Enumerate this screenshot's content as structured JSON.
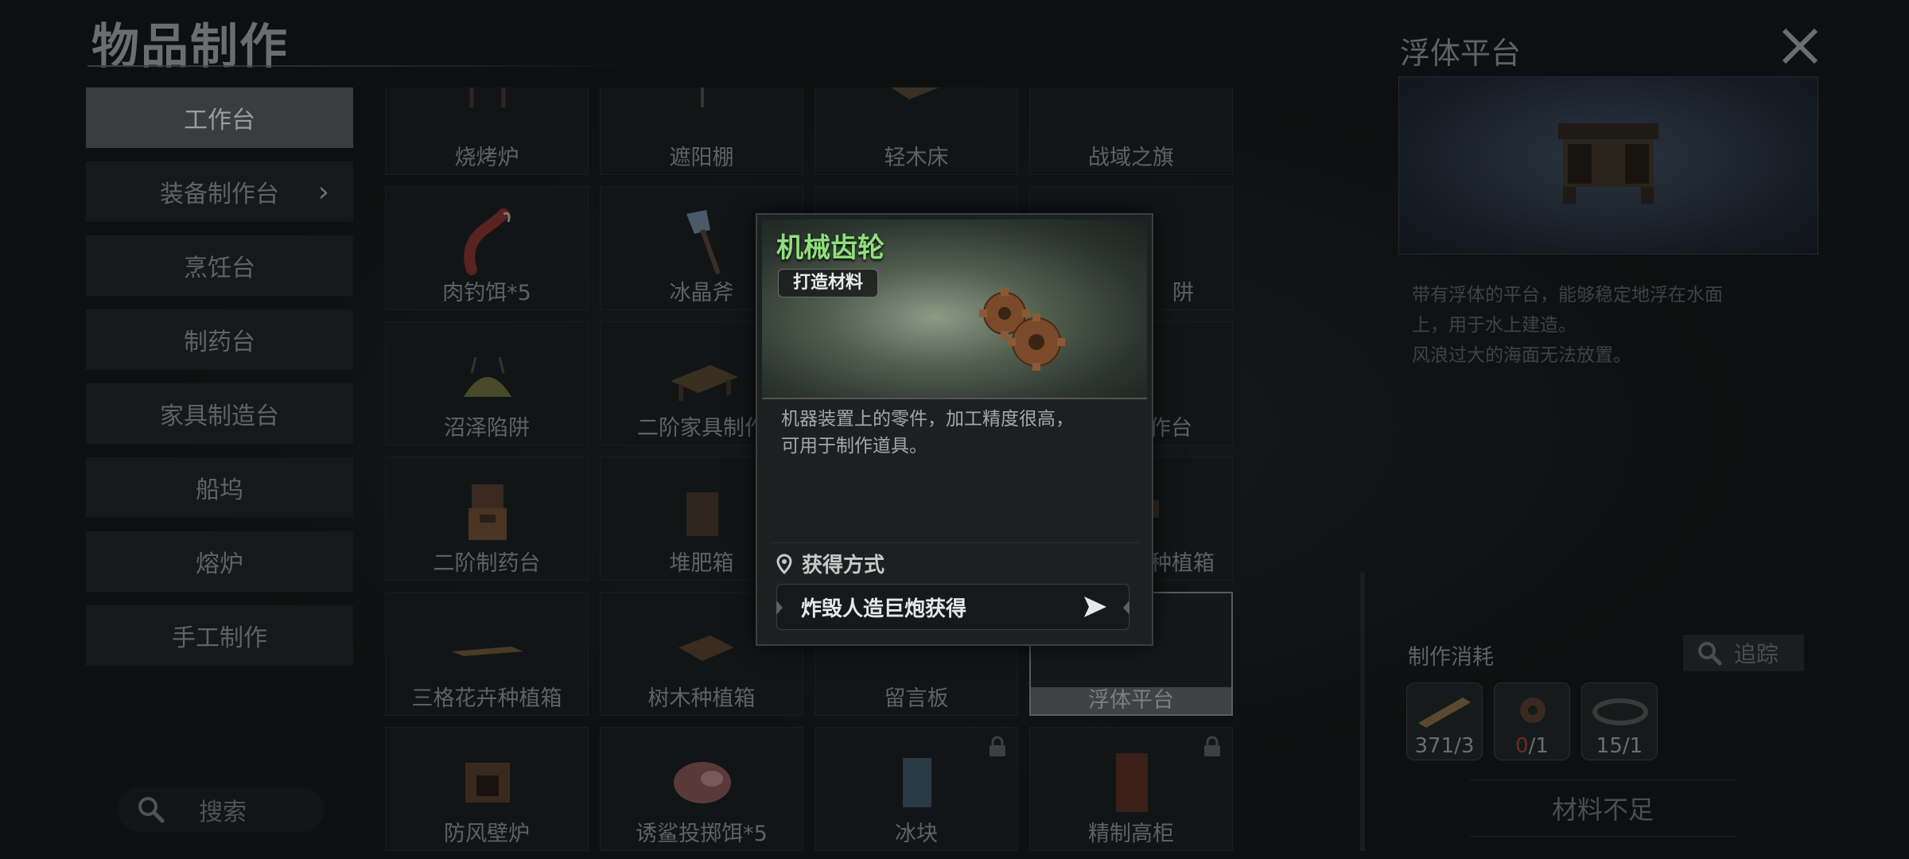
{
  "header": {
    "title": "物品制作"
  },
  "sidebar": {
    "items": [
      {
        "label": "工作台",
        "active": true
      },
      {
        "label": "装备制作台",
        "has_arrow": true
      },
      {
        "label": "烹饪台"
      },
      {
        "label": "制药台"
      },
      {
        "label": "家具制造台"
      },
      {
        "label": "船坞"
      },
      {
        "label": "熔炉"
      },
      {
        "label": "手工制作"
      }
    ],
    "search_label": "搜索"
  },
  "grid": {
    "items": [
      {
        "label": "烧烤炉"
      },
      {
        "label": "遮阳棚"
      },
      {
        "label": "轻木床"
      },
      {
        "label": "战域之旗"
      },
      {
        "label": "肉钓饵*5"
      },
      {
        "label": "冰晶斧"
      },
      {
        "label": ""
      },
      {
        "label": "阱"
      },
      {
        "label": "沼泽陷阱"
      },
      {
        "label": "二阶家具制作"
      },
      {
        "label": ""
      },
      {
        "label": "作台"
      },
      {
        "label": "二阶制药台"
      },
      {
        "label": "堆肥箱"
      },
      {
        "label": ""
      },
      {
        "label": "种植箱"
      },
      {
        "label": "三格花卉种植箱"
      },
      {
        "label": "树木种植箱"
      },
      {
        "label": "留言板"
      },
      {
        "label": "浮体平台",
        "selected": true
      },
      {
        "label": "防风壁炉"
      },
      {
        "label": "诱鲨投掷饵*5"
      },
      {
        "label": "冰块",
        "locked": true
      },
      {
        "label": "精制高柜",
        "locked": true
      }
    ]
  },
  "detail": {
    "title": "浮体平台",
    "description": "带有浮体的平台，能够稳定地浮在水面\n上，用于水上建造。\n风浪过大的海面无法放置。",
    "cost_title": "制作消耗",
    "track_label": "追踪",
    "materials": [
      {
        "have": "371",
        "need": "/3",
        "ok": true
      },
      {
        "have": "0",
        "need": "/1",
        "ok": false
      },
      {
        "have": "15",
        "need": "/1",
        "ok": true
      }
    ],
    "status_label": "材料不足"
  },
  "tooltip": {
    "name": "机械齿轮",
    "tag": "打造材料",
    "description": "机器装置上的零件，加工精度很高，\n可用于制作道具。",
    "obtain_title": "获得方式",
    "obtain_source": "炸毁人造巨炮获得"
  },
  "colors": {
    "item_name_green": "#8fe07a",
    "insufficient_red": "#6d2a24",
    "panel_bg": "#1c2021"
  }
}
